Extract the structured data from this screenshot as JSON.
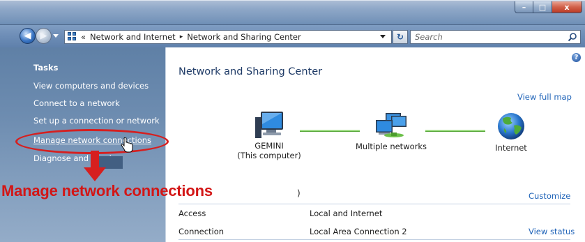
{
  "window": {
    "caption_min": "–",
    "caption_max": "□",
    "caption_close": "x"
  },
  "nav": {
    "back_glyph": "◀",
    "forward_glyph": "▶",
    "breadcrumb_overflow": "«",
    "breadcrumb": [
      "Network and Internet",
      "Network and Sharing Center"
    ],
    "breadcrumb_separator": "▸",
    "refresh_glyph": "↻",
    "search_placeholder": "Search"
  },
  "sidebar": {
    "title": "Tasks",
    "items": [
      {
        "label": "View computers and devices"
      },
      {
        "label": "Connect to a network"
      },
      {
        "label": "Set up a connection or network"
      },
      {
        "label": "Manage network connections"
      },
      {
        "label": "Diagnose and repair"
      }
    ]
  },
  "main": {
    "title": "Network and Sharing Center",
    "help_glyph": "?",
    "view_full_map": "View full map",
    "nodes": [
      {
        "label": "GEMINI",
        "sublabel": "(This computer)",
        "icon": "computer-icon"
      },
      {
        "label": "Multiple networks",
        "icon": "networks-icon"
      },
      {
        "label": "Internet",
        "icon": "globe-icon"
      }
    ],
    "section_trailing": ")",
    "customize": "Customize",
    "rows": [
      {
        "key": "Access",
        "value": "Local and Internet",
        "link": ""
      },
      {
        "key": "Connection",
        "value": "Local Area Connection 2",
        "link": "View status"
      }
    ]
  },
  "annotation": {
    "caption": "Manage network connections",
    "color": "#d31616"
  }
}
